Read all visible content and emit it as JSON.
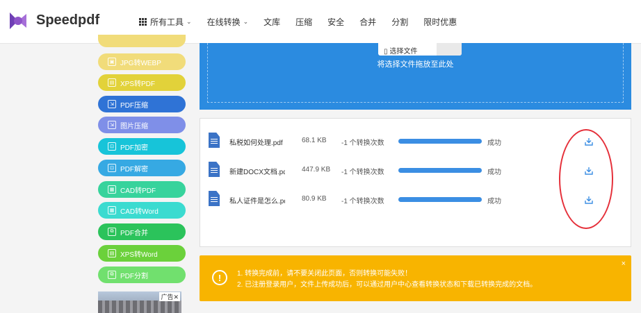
{
  "header": {
    "brand": "Speedpdf",
    "nav": [
      {
        "label": "所有工具",
        "dropdown": true,
        "icon": "grid-icon"
      },
      {
        "label": "在线转换",
        "dropdown": true
      },
      {
        "label": "文库"
      },
      {
        "label": "压缩"
      },
      {
        "label": "安全"
      },
      {
        "label": "合并"
      },
      {
        "label": "分割"
      },
      {
        "label": "限时优惠"
      }
    ]
  },
  "sidebar": {
    "items": [
      {
        "label": "JPG转WEBP",
        "color": "#f1dc7a"
      },
      {
        "label": "XPS转PDF",
        "color": "#e2d23a"
      },
      {
        "label": "PDF压缩",
        "color": "#2f73d6"
      },
      {
        "label": "图片压缩",
        "color": "#7f8fe8"
      },
      {
        "label": "PDF加密",
        "color": "#17c4d9"
      },
      {
        "label": "PDF解密",
        "color": "#36a9e3"
      },
      {
        "label": "CAD转PDF",
        "color": "#37d39c"
      },
      {
        "label": "CAD转Word",
        "color": "#3bdbd0"
      },
      {
        "label": "PDF合并",
        "color": "#2bc35b"
      },
      {
        "label": "XPS转Word",
        "color": "#6bd13b"
      },
      {
        "label": "PDF分割",
        "color": "#71e06e"
      }
    ],
    "top_partial_color": "#f1dc7a",
    "ad_label": "广告✕"
  },
  "upload": {
    "select_label": "选择文件",
    "drop_text": "将选择文件拖放至此处",
    "color": "#2b8be0"
  },
  "files": [
    {
      "name": "私税如何处理.pdf",
      "size": "68.1 KB",
      "count": "-1 个转换次数",
      "progress": 1.0,
      "status": "成功"
    },
    {
      "name": "新建DOCX文档.pdf",
      "size": "447.9 KB",
      "count": "-1 个转换次数",
      "progress": 1.0,
      "status": "成功"
    },
    {
      "name": "私人证件是怎么.pdf",
      "size": "80.9 KB",
      "count": "-1 个转换次数",
      "progress": 1.0,
      "status": "成功"
    }
  ],
  "notice": {
    "lines": [
      "1. 转换完成前，请不要关闭此页面，否则转换可能失败！",
      "2. 已注册登录用户，文件上传成功后，可以通过用户中心查看转换状态和下载已转换完成的文档。"
    ],
    "close": "×",
    "color": "#f8b400"
  }
}
